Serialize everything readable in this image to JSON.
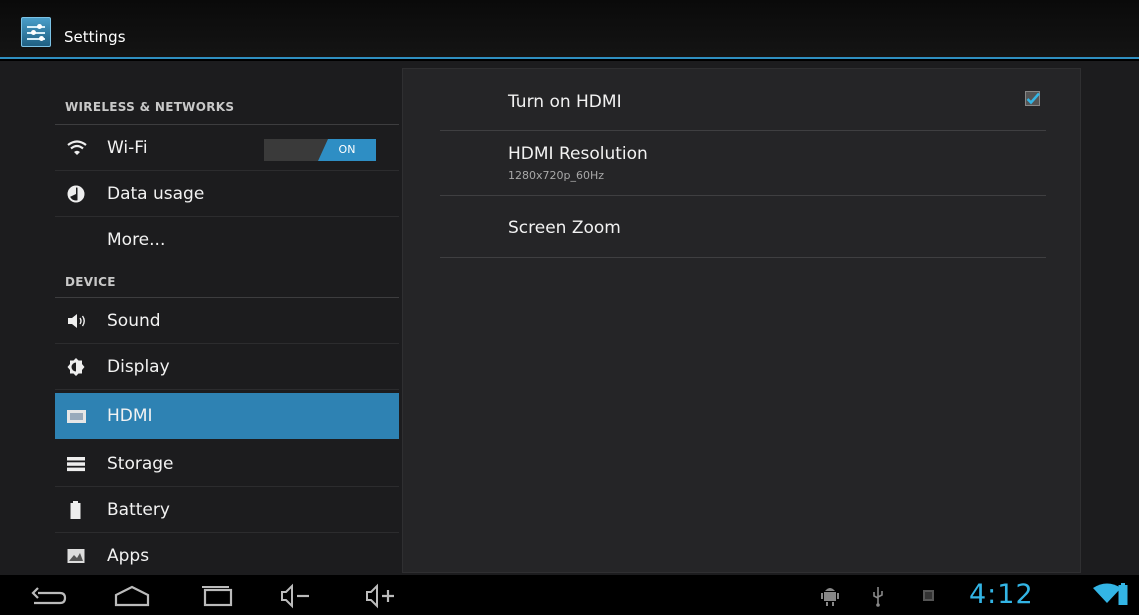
{
  "app": {
    "title": "Settings"
  },
  "sidebar": {
    "sections": [
      {
        "header": "WIRELESS & NETWORKS"
      },
      {
        "header": "DEVICE"
      }
    ],
    "items": [
      {
        "label": "Wi-Fi",
        "icon": "wifi-icon",
        "toggle": "ON"
      },
      {
        "label": "Data usage",
        "icon": "data-usage-icon"
      },
      {
        "label": "More..."
      },
      {
        "label": "Sound",
        "icon": "speaker-icon"
      },
      {
        "label": "Display",
        "icon": "brightness-icon"
      },
      {
        "label": "HDMI",
        "icon": "hdmi-icon",
        "selected": true
      },
      {
        "label": "Storage",
        "icon": "storage-icon"
      },
      {
        "label": "Battery",
        "icon": "battery-icon"
      },
      {
        "label": "Apps",
        "icon": "apps-icon"
      }
    ]
  },
  "content": {
    "prefs": [
      {
        "title": "Turn on HDMI",
        "checked": true
      },
      {
        "title": "HDMI Resolution",
        "summary": "1280x720p_60Hz"
      },
      {
        "title": "Screen Zoom"
      }
    ]
  },
  "navbar": {
    "clock": "4:12",
    "buttons": [
      "back-icon",
      "home-icon",
      "recent-apps-icon",
      "volume-down-icon",
      "volume-up-icon"
    ],
    "status_icons": [
      "android-debug-icon",
      "usb-icon",
      "notification-icon",
      "wifi-signal-icon",
      "battery-status-icon"
    ]
  },
  "colors": {
    "accent": "#33b5e5",
    "selected": "#2e82b3",
    "toggle_on": "#2e8ec4"
  }
}
